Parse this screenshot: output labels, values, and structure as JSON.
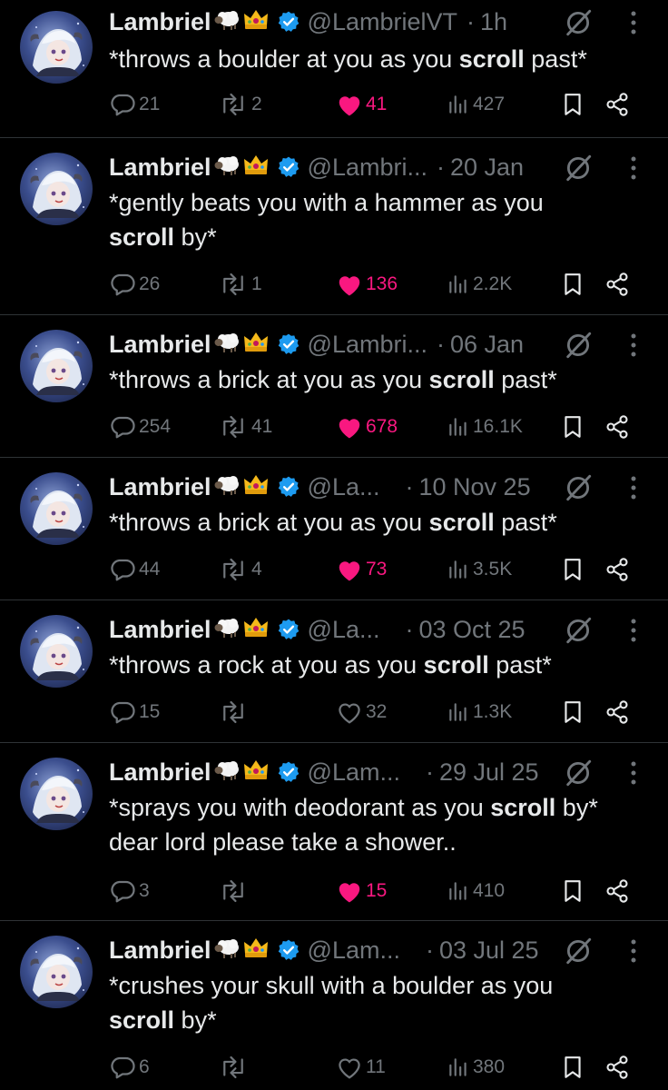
{
  "colors": {
    "background": "#000000",
    "text": "#e7e9ea",
    "muted": "#71767b",
    "like": "#f91880",
    "verified": "#1d9bf0",
    "divider": "#2f3336"
  },
  "icons": [
    "reply-icon",
    "retweet-icon",
    "heart-icon",
    "views-icon",
    "bookmark-icon",
    "share-icon",
    "grok-icon",
    "more-icon",
    "verified-badge-icon",
    "sheep-emoji",
    "crown-emoji"
  ],
  "tweets": [
    {
      "name": "Lambriel",
      "handle": "@LambrielVT",
      "time": "1h",
      "text_parts": [
        "*throws a boulder at you as you ",
        "scroll",
        " past*"
      ],
      "text2_parts": [
        "",
        "",
        ""
      ],
      "replies": "21",
      "retweets": "2",
      "likes": "41",
      "liked": true,
      "views": "427"
    },
    {
      "name": "Lambriel",
      "handle": "@Lambri...",
      "time": "20 Jan",
      "text_parts": [
        "*gently beats you with a hammer as you",
        "",
        ""
      ],
      "text2_parts": [
        "",
        "scroll",
        " by*"
      ],
      "replies": "26",
      "retweets": "1",
      "likes": "136",
      "liked": true,
      "views": "2.2K"
    },
    {
      "name": "Lambriel",
      "handle": "@Lambri...",
      "time": "06 Jan",
      "text_parts": [
        "*throws a brick at you as you ",
        "scroll",
        " past*"
      ],
      "text2_parts": [
        "",
        "",
        ""
      ],
      "replies": "254",
      "retweets": "41",
      "likes": "678",
      "liked": true,
      "views": "16.1K"
    },
    {
      "name": "Lambriel",
      "handle": "@La...",
      "time": "10 Nov 25",
      "text_parts": [
        "*throws a brick at you as you ",
        "scroll",
        " past*"
      ],
      "text2_parts": [
        "",
        "",
        ""
      ],
      "replies": "44",
      "retweets": "4",
      "likes": "73",
      "liked": true,
      "views": "3.5K"
    },
    {
      "name": "Lambriel",
      "handle": "@La...",
      "time": "03 Oct 25",
      "text_parts": [
        "*throws a rock at you as you ",
        "scroll",
        " past*"
      ],
      "text2_parts": [
        "",
        "",
        ""
      ],
      "replies": "15",
      "retweets": "",
      "likes": "32",
      "liked": false,
      "views": "1.3K"
    },
    {
      "name": "Lambriel",
      "handle": "@Lam...",
      "time": "29 Jul 25",
      "text_parts": [
        "*sprays you with deodorant as you ",
        "scroll",
        " by*"
      ],
      "text2_parts": [
        "dear lord please take a shower..",
        "",
        ""
      ],
      "replies": "3",
      "retweets": "",
      "likes": "15",
      "liked": true,
      "views": "410"
    },
    {
      "name": "Lambriel",
      "handle": "@Lam...",
      "time": "03 Jul 25",
      "text_parts": [
        "*crushes your skull with a boulder as you",
        "",
        ""
      ],
      "text2_parts": [
        "",
        "scroll",
        " by*"
      ],
      "replies": "6",
      "retweets": "",
      "likes": "11",
      "liked": false,
      "views": "380"
    }
  ]
}
